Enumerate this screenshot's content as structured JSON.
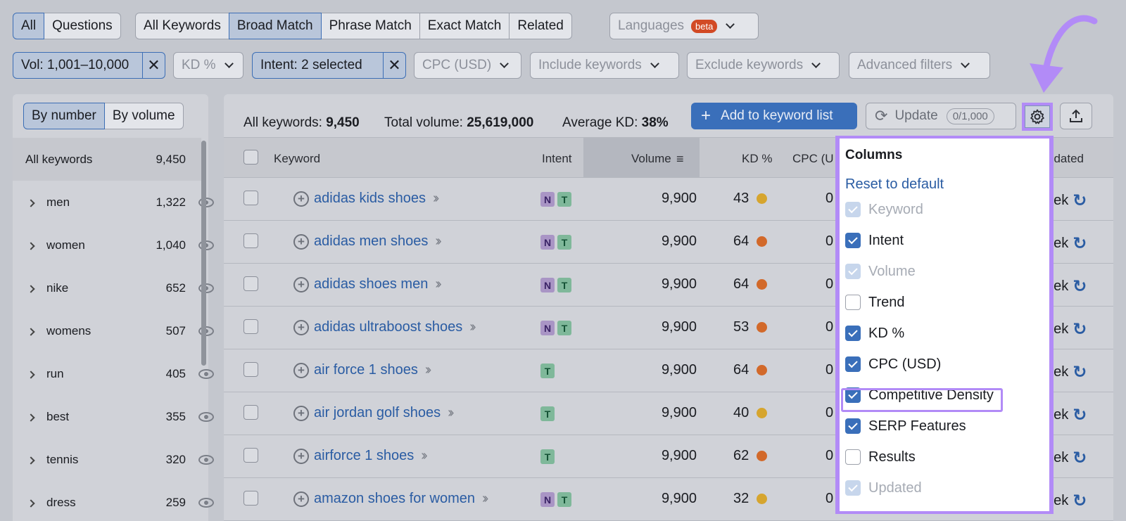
{
  "tabs_type": [
    {
      "label": "All",
      "active": true
    },
    {
      "label": "Questions",
      "active": false
    }
  ],
  "tabs_match": [
    {
      "label": "All Keywords",
      "active": false
    },
    {
      "label": "Broad Match",
      "active": true
    },
    {
      "label": "Phrase Match",
      "active": false
    },
    {
      "label": "Exact Match",
      "active": false
    },
    {
      "label": "Related",
      "active": false
    }
  ],
  "languages": {
    "label": "Languages",
    "badge": "beta"
  },
  "filters": {
    "volume": "Vol: 1,001–10,000",
    "kd": "KD %",
    "intent": "Intent: 2 selected",
    "cpc": "CPC (USD)",
    "include": "Include keywords",
    "exclude": "Exclude keywords",
    "advanced": "Advanced filters"
  },
  "left": {
    "toggle": [
      {
        "label": "By number",
        "active": true
      },
      {
        "label": "By volume",
        "active": false
      }
    ],
    "all_label": "All keywords",
    "all_count": "9,450",
    "groups": [
      {
        "label": "men",
        "count": "1,322"
      },
      {
        "label": "women",
        "count": "1,040"
      },
      {
        "label": "nike",
        "count": "652"
      },
      {
        "label": "womens",
        "count": "507"
      },
      {
        "label": "run",
        "count": "405"
      },
      {
        "label": "best",
        "count": "355"
      },
      {
        "label": "tennis",
        "count": "320"
      },
      {
        "label": "dress",
        "count": "259"
      }
    ]
  },
  "summary": {
    "all_label": "All keywords:",
    "all_value": "9,450",
    "vol_label": "Total volume:",
    "vol_value": "25,619,000",
    "kd_label": "Average KD:",
    "kd_value": "38%"
  },
  "actions": {
    "add_list": "Add to keyword list",
    "update": "Update",
    "update_count": "0/1,000"
  },
  "columns": {
    "keyword": "Keyword",
    "intent": "Intent",
    "volume": "Volume",
    "kd": "KD %",
    "cpc": "CPC (U",
    "updated": "pdated"
  },
  "rows": [
    {
      "keyword": "adidas kids shoes",
      "intent": [
        "N",
        "T"
      ],
      "volume": "9,900",
      "kd": "43",
      "kd_color": "#d6a52e",
      "cpc": "0",
      "updated": "eek"
    },
    {
      "keyword": "adidas men shoes",
      "intent": [
        "N",
        "T"
      ],
      "volume": "9,900",
      "kd": "64",
      "kd_color": "#d2692a",
      "cpc": "0",
      "updated": "eek"
    },
    {
      "keyword": "adidas shoes men",
      "intent": [
        "N",
        "T"
      ],
      "volume": "9,900",
      "kd": "64",
      "kd_color": "#d2692a",
      "cpc": "0",
      "updated": "eek"
    },
    {
      "keyword": "adidas ultraboost shoes",
      "intent": [
        "N",
        "T"
      ],
      "volume": "9,900",
      "kd": "53",
      "kd_color": "#d2692a",
      "cpc": "0",
      "updated": "eek"
    },
    {
      "keyword": "air force 1 shoes",
      "intent": [
        "T"
      ],
      "volume": "9,900",
      "kd": "64",
      "kd_color": "#d2692a",
      "cpc": "0",
      "updated": "eek"
    },
    {
      "keyword": "air jordan golf shoes",
      "intent": [
        "T"
      ],
      "volume": "9,900",
      "kd": "40",
      "kd_color": "#d6a52e",
      "cpc": "0",
      "updated": "eek"
    },
    {
      "keyword": "airforce 1 shoes",
      "intent": [
        "T"
      ],
      "volume": "9,900",
      "kd": "62",
      "kd_color": "#d2692a",
      "cpc": "0",
      "updated": "eek"
    },
    {
      "keyword": "amazon shoes for women",
      "intent": [
        "N",
        "T"
      ],
      "volume": "9,900",
      "kd": "32",
      "kd_color": "#d6a52e",
      "cpc": "0",
      "updated": "eek"
    }
  ],
  "columns_menu": {
    "title": "Columns",
    "reset": "Reset to default",
    "options": [
      {
        "label": "Keyword",
        "state": "dis"
      },
      {
        "label": "Intent",
        "state": "on"
      },
      {
        "label": "Volume",
        "state": "dis"
      },
      {
        "label": "Trend",
        "state": "off"
      },
      {
        "label": "KD %",
        "state": "on"
      },
      {
        "label": "CPC (USD)",
        "state": "on"
      },
      {
        "label": "Competitive Density",
        "state": "on"
      },
      {
        "label": "SERP Features",
        "state": "on"
      },
      {
        "label": "Results",
        "state": "off"
      },
      {
        "label": "Updated",
        "state": "dis"
      }
    ]
  },
  "colors": {
    "accent": "#3a6fba",
    "highlight": "#b28bf7",
    "link": "#2a5ca3"
  }
}
